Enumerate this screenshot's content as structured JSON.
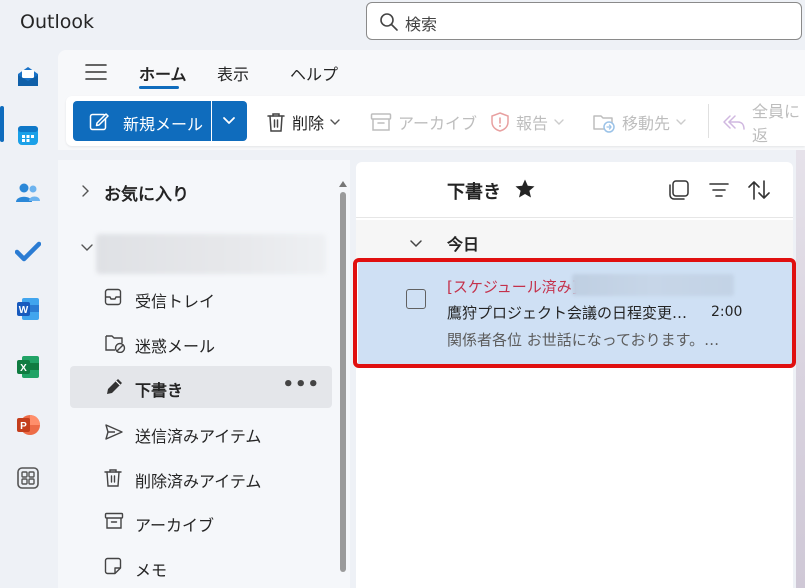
{
  "app": {
    "title": "Outlook"
  },
  "search": {
    "placeholder": "検索"
  },
  "rail": [
    {
      "name": "mail",
      "active": true
    },
    {
      "name": "calendar"
    },
    {
      "name": "people"
    },
    {
      "name": "todo"
    },
    {
      "name": "word"
    },
    {
      "name": "excel"
    },
    {
      "name": "powerpoint"
    },
    {
      "name": "apps"
    }
  ],
  "ribbon": {
    "tabs": {
      "home": "ホーム",
      "view": "表示",
      "help": "ヘルプ"
    },
    "new_mail": "新規メール",
    "delete": "削除",
    "archive": "アーカイブ",
    "report": "報告",
    "move": "移動先",
    "reply_all": "全員に返"
  },
  "folders": {
    "favorites": "お気に入り",
    "items": [
      {
        "label": "受信トレイ",
        "icon": "inbox-icon"
      },
      {
        "label": "迷惑メール",
        "icon": "junk-folder-icon"
      },
      {
        "label": "下書き",
        "icon": "pencil-icon",
        "selected": true,
        "more": "•••"
      },
      {
        "label": "送信済みアイテム",
        "icon": "send-icon"
      },
      {
        "label": "削除済みアイテム",
        "icon": "trash-icon"
      },
      {
        "label": "アーカイブ",
        "icon": "archive-icon"
      },
      {
        "label": "メモ",
        "icon": "note-icon"
      }
    ]
  },
  "list": {
    "title": "下書き",
    "group": "今日",
    "messages": [
      {
        "tag": "[スケジュール済み]",
        "subject": "鷹狩プロジェクト会議の日程変更のお知らせ",
        "time": "2:00",
        "preview": "関係者各位 お世話になっております。株式会社"
      }
    ]
  },
  "colors": {
    "accent": "#0f6cbd",
    "selected_row": "#cfe0f4",
    "highlight": "#e00f0f",
    "scheduled": "#c4314b"
  }
}
